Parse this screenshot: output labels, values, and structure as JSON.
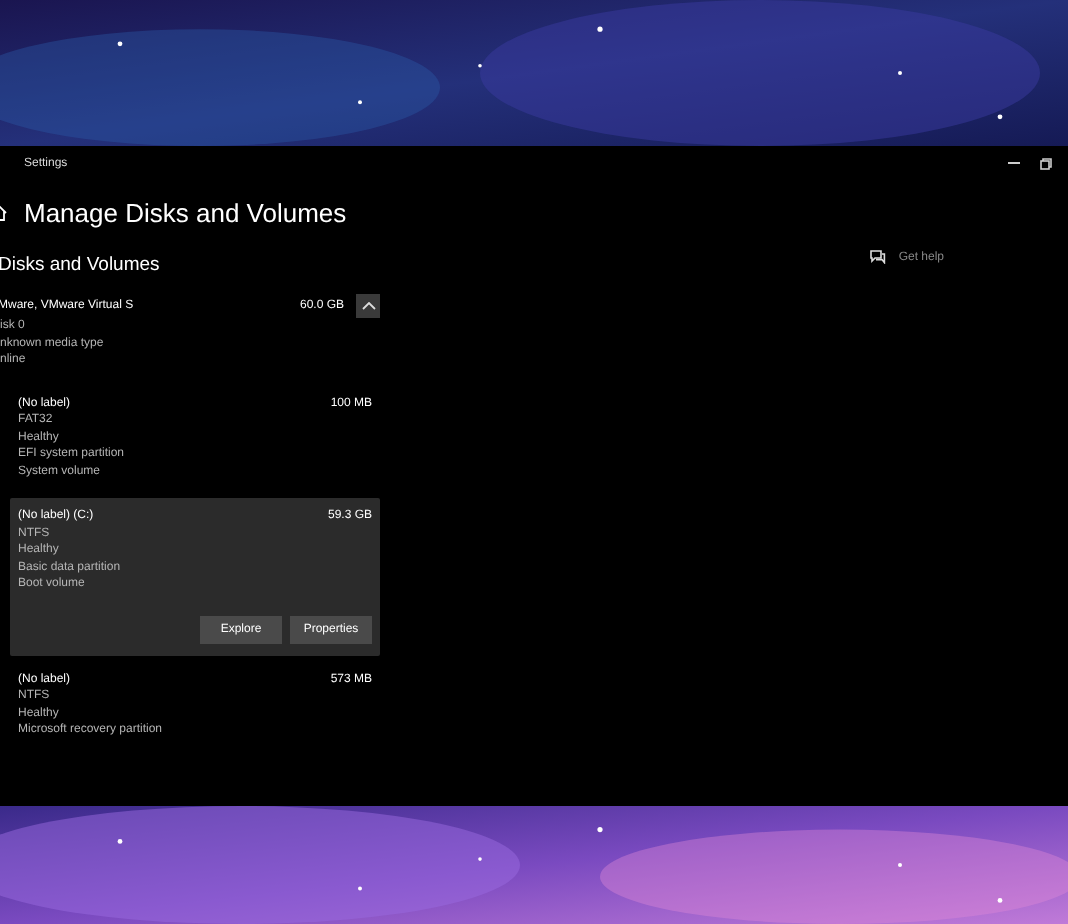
{
  "window": {
    "title": "Settings"
  },
  "page": {
    "title": "Manage Disks and Volumes",
    "section": "Disks and Volumes"
  },
  "help": {
    "label": "Get help"
  },
  "disk": {
    "name": "Mware, VMware Virtual S",
    "size": "60.0 GB",
    "expanded": true,
    "details": [
      "isk 0",
      "nknown media type",
      "nline"
    ]
  },
  "partitions": [
    {
      "label": "(No label)",
      "size": "100 MB",
      "selected": false,
      "details": [
        "FAT32",
        "Healthy",
        "EFI system partition",
        "System volume"
      ]
    },
    {
      "label": "(No label) (C:)",
      "size": "59.3 GB",
      "selected": true,
      "details": [
        "NTFS",
        "Healthy",
        "Basic data partition",
        "Boot volume"
      ],
      "actions": [
        "Explore",
        "Properties"
      ]
    },
    {
      "label": "(No label)",
      "size": "573 MB",
      "selected": false,
      "details": [
        "NTFS",
        "Healthy",
        "Microsoft recovery partition"
      ]
    }
  ]
}
